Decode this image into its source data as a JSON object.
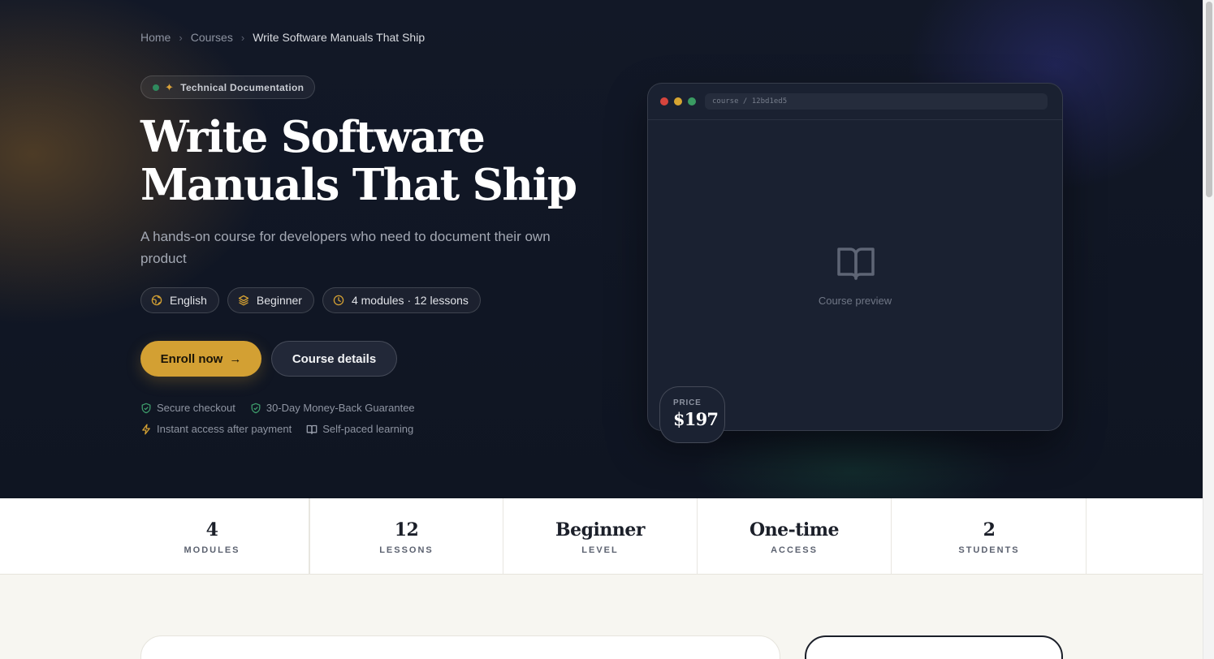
{
  "breadcrumb": {
    "home": "Home",
    "courses": "Courses",
    "current": "Write Software Manuals That Ship",
    "separator": "›"
  },
  "category_tag": "Technical Documentation",
  "title": "Write Software Manuals That Ship",
  "subtitle": "A hands-on course for developers who need to document their own product",
  "chips": {
    "language": "English",
    "level": "Beginner",
    "structure": "4 modules · 12 lessons"
  },
  "buttons": {
    "enroll": "Enroll now",
    "enroll_arrow": "→",
    "details": "Course details"
  },
  "trust": {
    "secure": "Secure checkout",
    "guarantee": "30-Day Money-Back Guarantee",
    "instant": "Instant access after payment",
    "self_paced": "Self-paced learning"
  },
  "preview": {
    "url": "course / 12bd1ed5",
    "label": "Course preview"
  },
  "price": {
    "label": "PRICE",
    "value": "$197"
  },
  "stats": [
    {
      "value": "4",
      "label": "MODULES"
    },
    {
      "value": "12",
      "label": "LESSONS"
    },
    {
      "value": "Beginner",
      "label": "LEVEL"
    },
    {
      "value": "One-time",
      "label": "ACCESS"
    },
    {
      "value": "2",
      "label": "STUDENTS"
    }
  ],
  "colors": {
    "accent": "#d3a033",
    "hero_bg": "#121827",
    "success": "#3e9c6b"
  },
  "icons": {
    "language": "globe-icon",
    "level": "layers-icon",
    "duration": "clock-icon",
    "secure": "shield-check-icon",
    "instant": "lightning-icon",
    "self_paced": "book-icon"
  }
}
